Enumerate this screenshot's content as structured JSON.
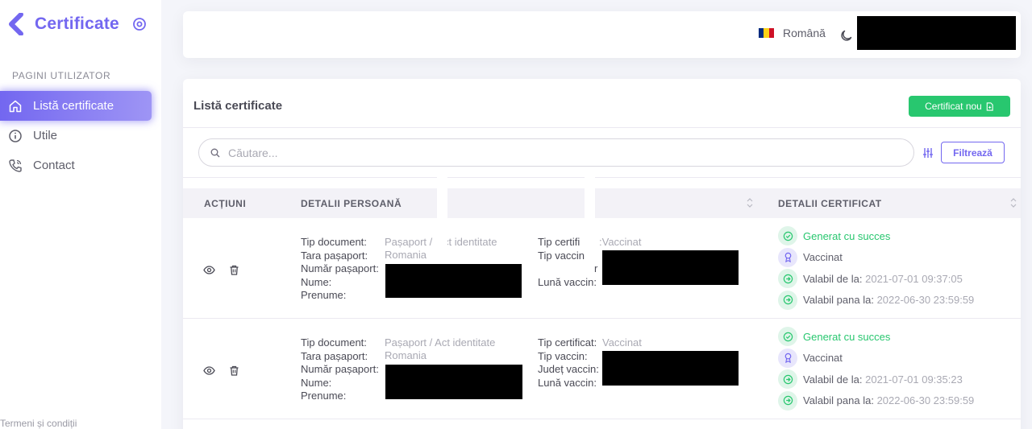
{
  "app": {
    "title": "Certificate"
  },
  "sidebar": {
    "section_label": "PAGINI UTILIZATOR",
    "items": [
      {
        "label": "Listă certificate",
        "icon": "home-icon"
      },
      {
        "label": "Utile",
        "icon": "info-icon"
      },
      {
        "label": "Contact",
        "icon": "phone-icon"
      }
    ],
    "footer": "Termeni și condiții"
  },
  "navbar": {
    "language": "Română",
    "flag_colors": [
      "#002b7f",
      "#fcd116",
      "#ce1126"
    ]
  },
  "card": {
    "title": "Listă certificate",
    "new_button": "Certificat nou",
    "search_placeholder": "Căutare...",
    "filter_button": "Filtrează"
  },
  "table": {
    "headers": [
      "ACȚIUNI",
      "DETALII PERSOANĂ",
      "DETALII CERTIFICAT"
    ],
    "rows": [
      {
        "person_labels": [
          "Tip document:",
          "Tara pașaport:",
          "Număr pașaport:",
          "Nume:",
          "Prenume:"
        ],
        "doc_type_a": "Pașaport /",
        "doc_type_b": "ct identitate",
        "country": "Romania",
        "cert_labels": [
          "Tip certifi",
          "Tip vaccin",
          "r",
          "Lună vaccin:"
        ],
        "cert_type": ":Vaccinat",
        "statuses": [
          "Generat cu succes",
          "Vaccinat"
        ],
        "valid_from_label": "Valabil de la:",
        "valid_from": "2021-07-01 09:37:05",
        "valid_to_label": "Valabil pana la:",
        "valid_to": "2022-06-30 23:59:59"
      },
      {
        "person_labels": [
          "Tip document:",
          "Tara pașaport:",
          "Număr pașaport:",
          "Nume:",
          "Prenume:"
        ],
        "doc_type_a": "Pașaport / Act identitate",
        "doc_type_b": "",
        "country": "Romania",
        "cert_labels": [
          "Tip certificat:",
          "Tip vaccin:",
          "Județ vaccin:",
          "Lună vaccin:"
        ],
        "cert_type": "Vaccinat",
        "statuses": [
          "Generat cu succes",
          "Vaccinat"
        ],
        "valid_from_label": "Valabil de la:",
        "valid_from": "2021-07-01 09:35:23",
        "valid_to_label": "Valabil pana la:",
        "valid_to": "2022-06-30 23:59:59"
      }
    ]
  },
  "colors": {
    "primary": "#7367f0",
    "success": "#28c76f"
  }
}
